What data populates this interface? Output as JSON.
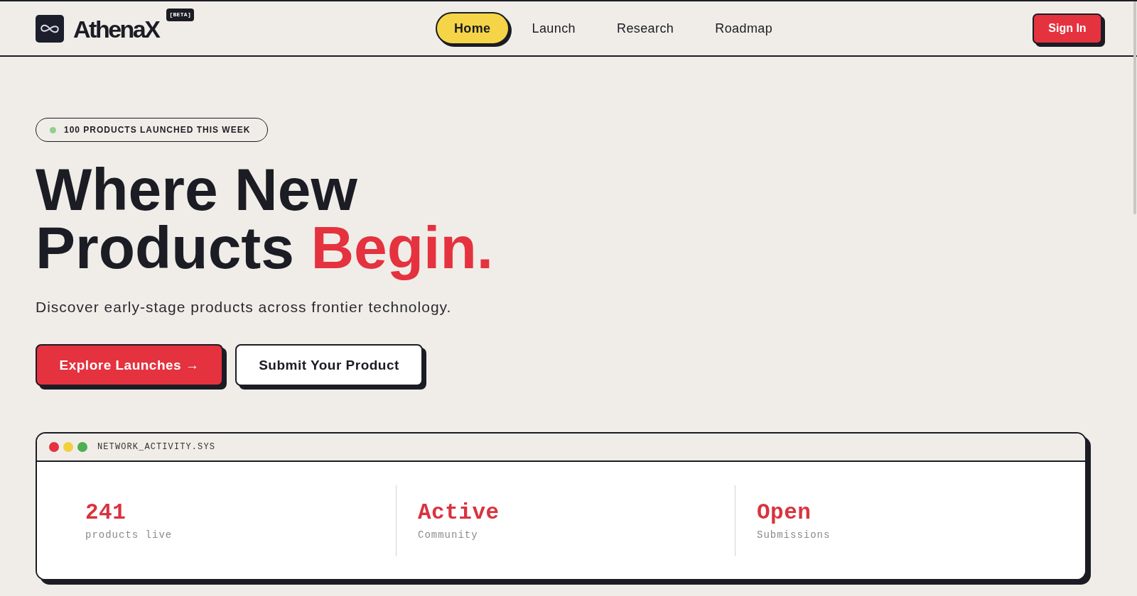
{
  "header": {
    "brand": "AthenaX",
    "badge": "[BETA]",
    "nav": [
      {
        "label": "Home",
        "selected": true
      },
      {
        "label": "Launch",
        "selected": false
      },
      {
        "label": "Research",
        "selected": false
      },
      {
        "label": "Roadmap",
        "selected": false
      }
    ],
    "sign_in": "Sign In"
  },
  "hero": {
    "announcement": "100 PRODUCTS LAUNCHED THIS WEEK",
    "heading": [
      [
        {
          "text": "Where New",
          "accent": false
        }
      ],
      [
        {
          "text": "Products",
          "accent": false
        },
        {
          "text": "Begin.",
          "accent": true
        }
      ]
    ],
    "subtitle": "Discover early-stage products across frontier technology.",
    "actions": [
      {
        "label": "Explore Launches →",
        "kind": "primary"
      },
      {
        "label": "Submit Your Product",
        "kind": "secondary"
      }
    ]
  },
  "window": {
    "title": "NETWORK_ACTIVITY.SYS",
    "stats": [
      {
        "value": "241",
        "label": "products live"
      },
      {
        "value": "Active",
        "label": "Community"
      },
      {
        "value": "Open",
        "label": "Submissions"
      }
    ]
  }
}
